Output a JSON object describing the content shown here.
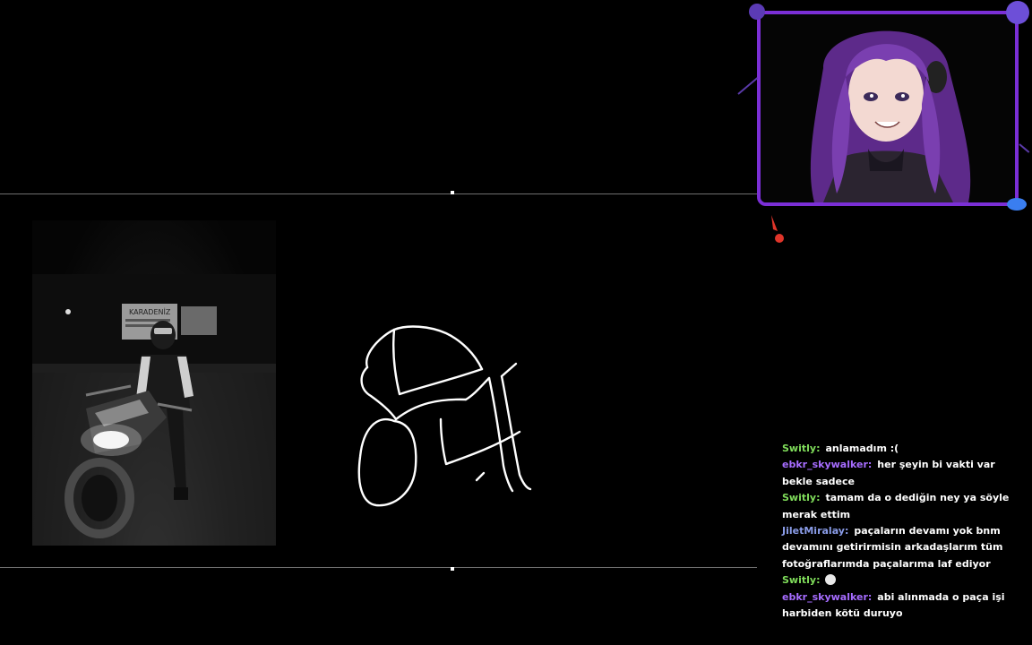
{
  "stream": {
    "accent": "#7b2fd6"
  },
  "webcam": {
    "avatar": "purple-haired-anime-vtuber"
  },
  "media": {
    "photo_subject": "motorcyclist-at-night",
    "sign_text": "KARADENİZ"
  },
  "drawing": {
    "subject": "motorcycle-sketch"
  },
  "chat": {
    "messages": [
      {
        "user": "Switly",
        "color": "#7fdc5a",
        "text": "anlamadım :("
      },
      {
        "user": "ebkr_skywalker",
        "color": "#a66cff",
        "text": "her şeyin bi vakti var bekle sadece"
      },
      {
        "user": "Switly",
        "color": "#7fdc5a",
        "text": "tamam da o dediğin ney ya söyle merak ettim"
      },
      {
        "user": "JiletMiralay",
        "color": "#8a9ce8",
        "text": "paçaların devamı yok bnm devamını getirirmisin arkadaşlarım tüm fotoğraflarımda paçalarıma laf ediyor"
      },
      {
        "user": "Switly",
        "color": "#7fdc5a",
        "text": "",
        "emote": "ghost-emote"
      },
      {
        "user": "ebkr_skywalker",
        "color": "#a66cff",
        "text": "abi alınmada o paça işi harbiden kötü duruyo"
      }
    ]
  }
}
